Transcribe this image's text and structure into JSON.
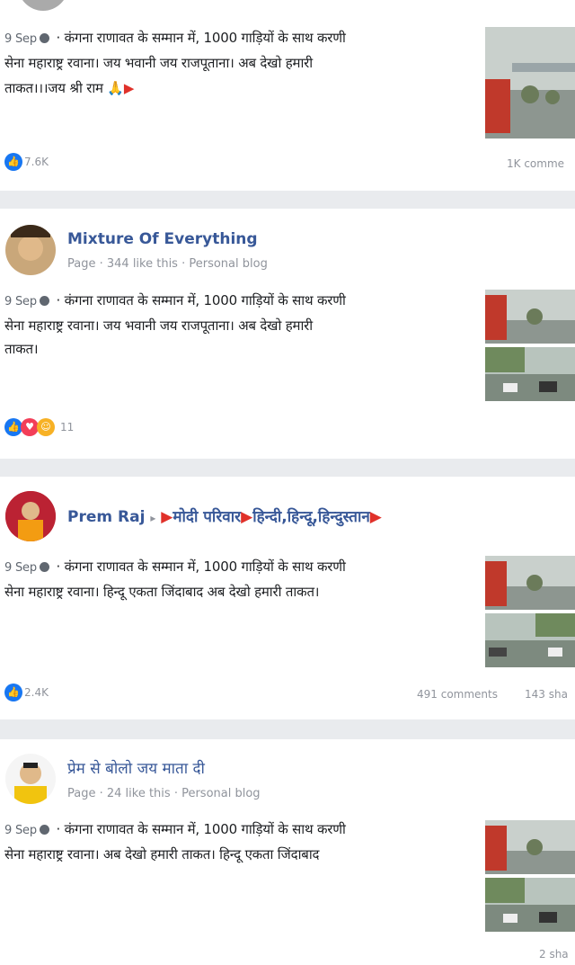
{
  "posts": [
    {
      "date": "9 Sep",
      "line1": "कंगना राणावत के सम्मान में, 1000 गाड़ियों के साथ करणी",
      "line2": "सेना महाराष्ट्र रवाना। जय भवानी जय राजपूताना। अब देखो हमारी",
      "line3": "ताकत।।।जय श्री राम 🙏",
      "reactions": "7.6K",
      "comments": "1K comme"
    },
    {
      "author": "Mixture Of Everything",
      "meta": "Page · 344 like this · Personal blog",
      "date": "9 Sep",
      "line1": "कंगना राणावत के सम्मान में, 1000 गाड़ियों के साथ करणी",
      "line2": "सेना महाराष्ट्र रवाना। जय भवानी जय राजपूताना। अब देखो हमारी",
      "line3": "ताकत।",
      "reactions": "11"
    },
    {
      "author": "Prem Raj",
      "group": "मोदी परिवार",
      "group2": "हिन्दी,हिन्दू,हिन्दुस्तान",
      "date": "9 Sep",
      "line1": "कंगना राणावत के सम्मान में, 1000 गाड़ियों के साथ करणी",
      "line2": "सेना महाराष्ट्र रवाना। हिन्दू एकता जिंदाबाद अब देखो हमारी ताकत।",
      "reactions": "2.4K",
      "comments": "491 comments",
      "shares": "143 sha"
    },
    {
      "author": "प्रेम से बोलो जय माता दी",
      "meta": "Page · 24 like this · Personal blog",
      "date": "9 Sep",
      "line1": "कंगना राणावत के सम्मान में, 1000 गाड़ियों के साथ करणी",
      "line2": "सेना महाराष्ट्र रवाना। अब देखो हमारी ताकत। हिन्दू एकता जिंदाबाद",
      "shares": "2 sha"
    }
  ],
  "colors": {
    "link": "#385898",
    "like": "#1877f2",
    "love": "#f33e58",
    "haha": "#f7b125",
    "flag": "#e0312a"
  }
}
